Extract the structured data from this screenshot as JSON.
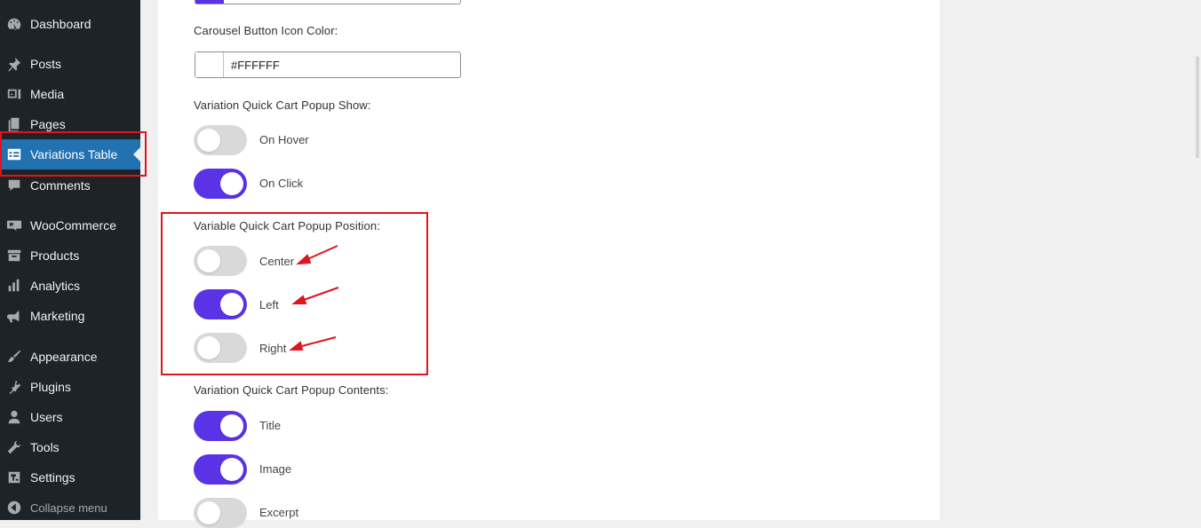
{
  "sidebar": {
    "items": [
      {
        "label": "Dashboard",
        "icon": "dashboard-icon"
      },
      {
        "label": "Posts",
        "icon": "pushpin-icon"
      },
      {
        "label": "Media",
        "icon": "media-icon"
      },
      {
        "label": "Pages",
        "icon": "pages-icon"
      },
      {
        "label": "Variations Table",
        "icon": "table-icon",
        "active": true
      },
      {
        "label": "Comments",
        "icon": "comment-icon"
      },
      {
        "label": "WooCommerce",
        "icon": "woocommerce-icon"
      },
      {
        "label": "Products",
        "icon": "archive-icon"
      },
      {
        "label": "Analytics",
        "icon": "bar-chart-icon"
      },
      {
        "label": "Marketing",
        "icon": "megaphone-icon"
      },
      {
        "label": "Appearance",
        "icon": "paintbrush-icon"
      },
      {
        "label": "Plugins",
        "icon": "plugin-icon"
      },
      {
        "label": "Users",
        "icon": "user-icon"
      },
      {
        "label": "Tools",
        "icon": "wrench-icon"
      },
      {
        "label": "Settings",
        "icon": "settings-icon"
      }
    ],
    "collapse_label": "Collapse menu"
  },
  "settings": {
    "icon_color_label": "Carousel Button Icon Color:",
    "icon_color_value": "#FFFFFF",
    "popup_show": {
      "label": "Variation Quick Cart Popup Show:",
      "options": [
        {
          "label": "On Hover",
          "on": false
        },
        {
          "label": "On Click",
          "on": true
        }
      ]
    },
    "popup_position": {
      "label": "Variable Quick Cart Popup Position:",
      "options": [
        {
          "label": "Center",
          "on": false
        },
        {
          "label": "Left",
          "on": true
        },
        {
          "label": "Right",
          "on": false
        }
      ]
    },
    "popup_contents": {
      "label": "Variation Quick Cart Popup Contents:",
      "options": [
        {
          "label": "Title",
          "on": true
        },
        {
          "label": "Image",
          "on": true
        },
        {
          "label": "Excerpt",
          "on": false
        }
      ]
    }
  },
  "colors": {
    "accent": "#5b33e6",
    "sidebar_bg": "#1d2327",
    "active_bg": "#2271b1",
    "highlight": "#e0141e"
  }
}
